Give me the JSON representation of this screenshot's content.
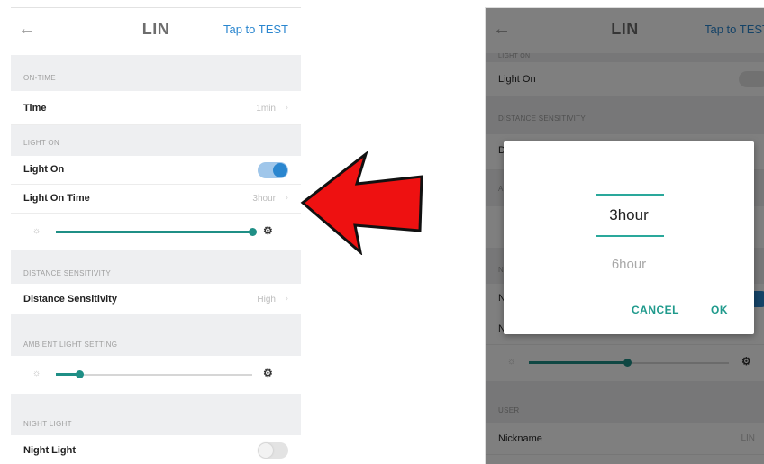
{
  "left_screen": {
    "header": {
      "back_icon": "arrow-left-icon",
      "title": "LIN",
      "action_label": "Tap to TEST"
    },
    "sections": {
      "on_time": "ON-TIME",
      "light_on": "LIGHT ON",
      "distance_sensitivity": "DISTANCE SENSITIVITY",
      "ambient_light": "AMBIENT LIGHT SETTING",
      "night_light": "NIGHT LIGHT"
    },
    "rows": {
      "time_label": "Time",
      "time_value": "1min",
      "light_on_label": "Light On",
      "light_on_toggle": true,
      "light_on_time_label": "Light On Time",
      "light_on_time_value": "3hour",
      "distance_label": "Distance Sensitivity",
      "distance_value": "High",
      "night_light_label": "Night Light",
      "night_light_toggle": false
    },
    "sliders": {
      "light_on_brightness": 1.0,
      "ambient_light": 0.12
    },
    "colors": {
      "accent": "#1f8f86",
      "toggle_on": "#2a86cf",
      "link": "#2a86cf"
    }
  },
  "annotation": {
    "arrow_color": "#ee1111",
    "arrow_icon": "arrow-left-icon"
  },
  "right_screen": {
    "header": {
      "back_icon": "arrow-left-icon",
      "title": "LIN",
      "action_label": "Tap to TEST"
    },
    "background": {
      "partial_section": "LIGHT ON",
      "light_on_label": "Light On",
      "distance_section": "DISTANCE SENSITIVITY",
      "distance_row_initial": "D",
      "ambient_initial": "A",
      "night_initial": "N",
      "night_row1_initial": "N",
      "night_row2_initial": "N",
      "user_section": "USER",
      "nickname_label": "Nickname",
      "nickname_value": "LIN"
    },
    "dialog": {
      "selected_option": "3hour",
      "other_option": "6hour",
      "cancel_label": "CANCEL",
      "ok_label": "OK"
    }
  }
}
